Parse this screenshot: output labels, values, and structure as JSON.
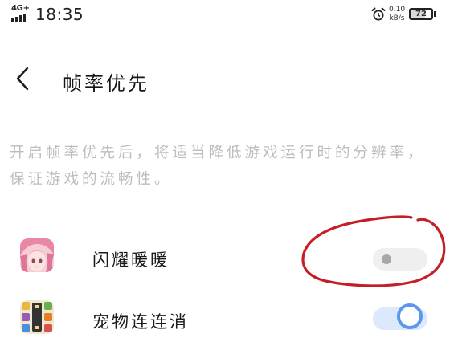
{
  "status_bar": {
    "network_type": "4G+",
    "time": "18:35",
    "net_speed_value": "0.10",
    "net_speed_unit": "kB/s",
    "battery_level": "72",
    "battery_fraction": 0.72
  },
  "header": {
    "back_icon": "chevron-left-icon",
    "title": "帧率优先"
  },
  "description": "开启帧率优先后，将适当降低游戏运行时的分辨率，保证游戏的流畅性。",
  "apps": [
    {
      "name": "闪耀暖暖",
      "icon": "shining-nikki-app-icon",
      "enabled": false
    },
    {
      "name": "宠物连连消",
      "icon": "pet-match-app-icon",
      "enabled": true
    }
  ],
  "colors": {
    "accent": "#5b96ef",
    "toggle_on_track": "#dce8fb",
    "toggle_off_track": "#efefef",
    "annotation": "#c41e26",
    "description_text": "#bdbdbd"
  }
}
